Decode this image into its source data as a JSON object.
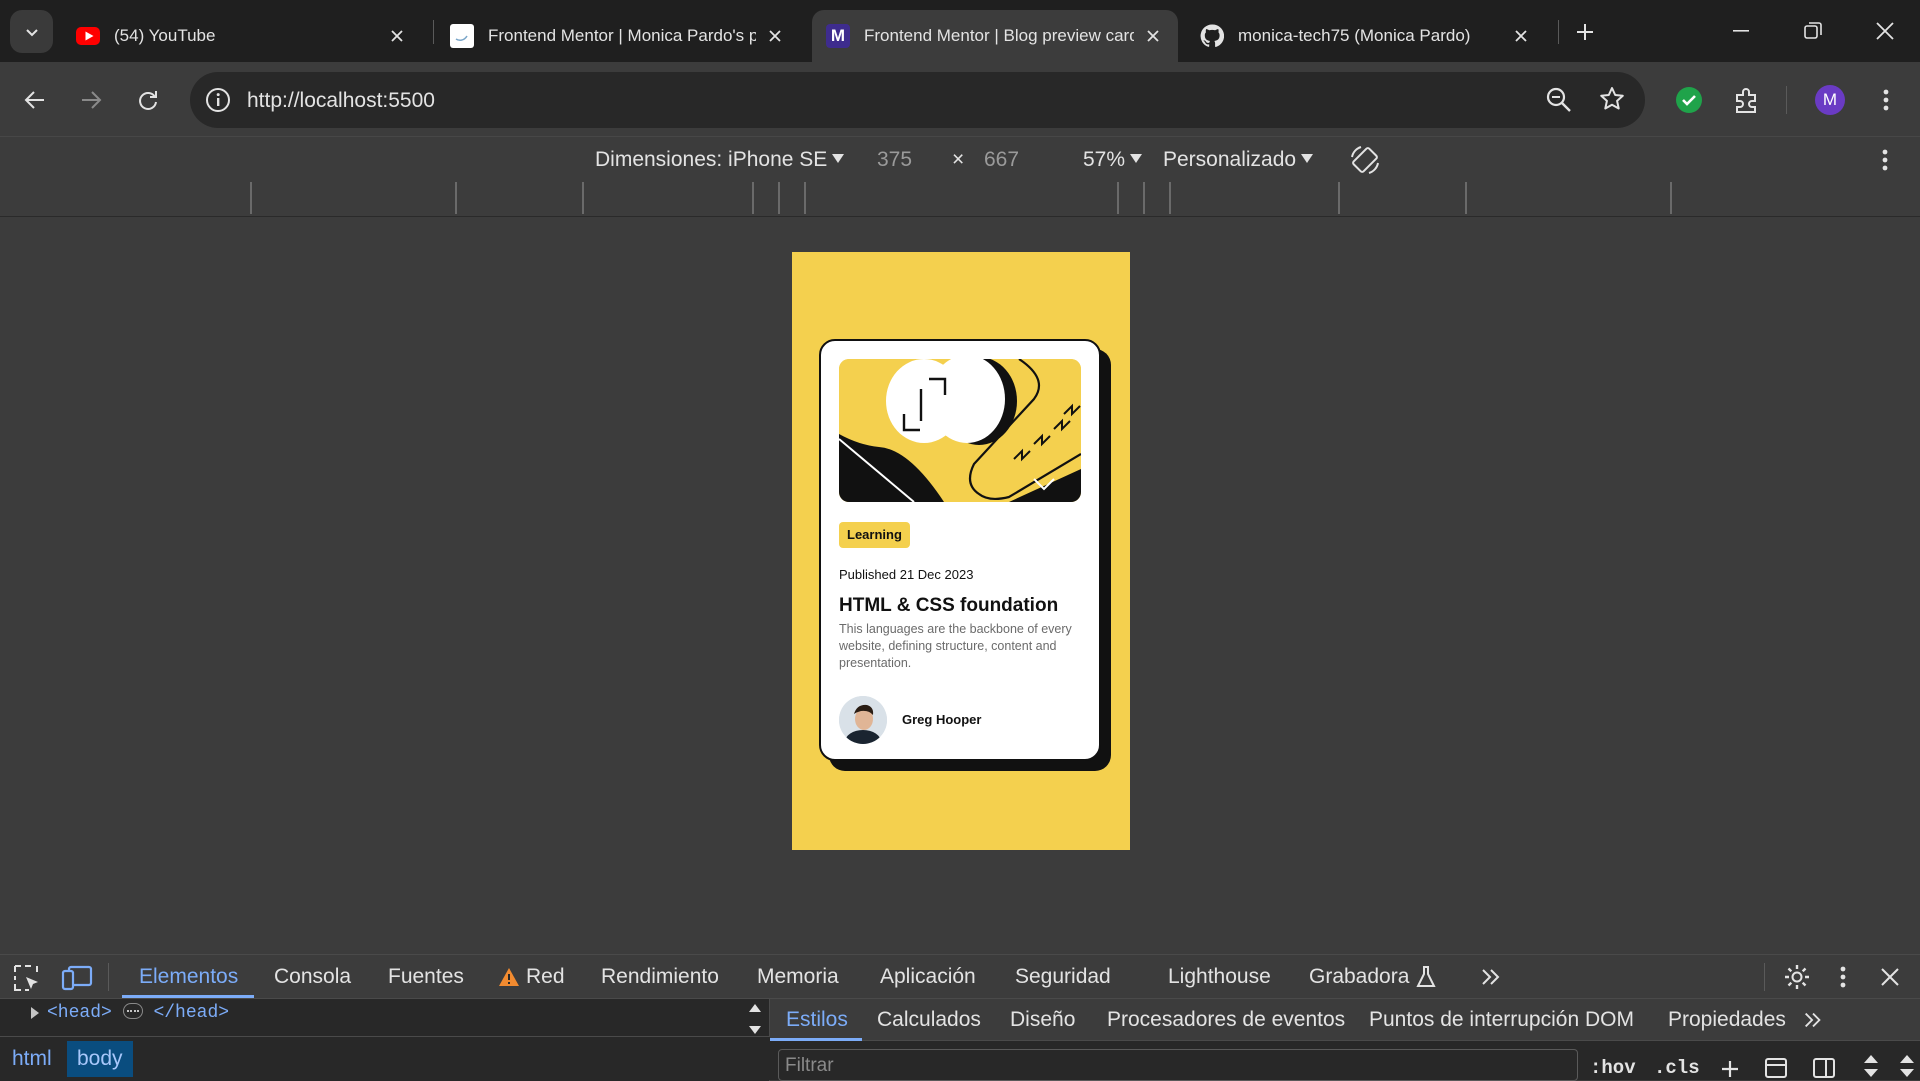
{
  "browser": {
    "tabs": [
      {
        "title": "(54) YouTube",
        "favicon": "youtube-icon"
      },
      {
        "title": "Frontend Mentor | Monica Pardo's pro",
        "favicon": "frontend-mentor-page-icon"
      },
      {
        "title": "Frontend Mentor | Blog preview card",
        "favicon": "frontend-mentor-m-icon",
        "favicon_letter": "M"
      },
      {
        "title": "monica-tech75 (Monica Pardo)",
        "favicon": "github-icon"
      }
    ],
    "url": "http://localhost:5500",
    "profile_initial": "M",
    "colors": {
      "accent": "#7cacf8",
      "youtube": "#ff0000",
      "fm_purple": "#3e2c8e",
      "check_green": "#1fa34a",
      "profile": "#6a3bc4"
    }
  },
  "device_toolbar": {
    "dimensions_label": "Dimensiones: iPhone SE",
    "width": "375",
    "times": "×",
    "height": "667",
    "zoom": "57%",
    "throttle": "Personalizado"
  },
  "card": {
    "category": "Learning",
    "published": "Published 21 Dec 2023",
    "title": "HTML & CSS foundation",
    "description": "This languages are the backbone of every website, defining structure, content and presentation.",
    "author": "Greg Hooper",
    "colors": {
      "yellow": "#f4d04e",
      "black": "#111111",
      "gray": "#6b6b6b"
    }
  },
  "devtools": {
    "tabs": [
      "Elementos",
      "Consola",
      "Fuentes",
      "Red",
      "Rendimiento",
      "Memoria",
      "Aplicación",
      "Seguridad",
      "Lighthouse",
      "Grabadora"
    ],
    "code_line_open": "<head>",
    "code_line_close": "</head>",
    "breadcrumbs": [
      "html",
      "body"
    ],
    "styles_tabs": [
      "Estilos",
      "Calculados",
      "Diseño",
      "Procesadores de eventos",
      "Puntos de interrupción DOM",
      "Propiedades"
    ],
    "filter_placeholder": "Filtrar",
    "hov": ":hov",
    "cls": ".cls"
  }
}
